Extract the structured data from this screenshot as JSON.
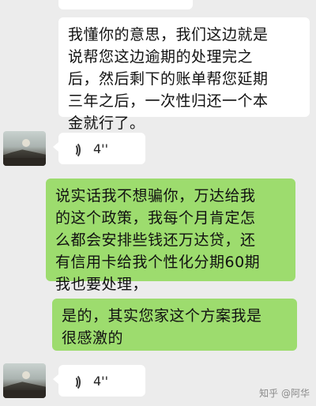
{
  "messages": [
    {
      "lines": [
        "我懂你的意思，我们这边就是",
        "说帮您这边逾期的处理完之",
        "后，然后剩下的账单帮您延期",
        "三年之后，一次性归还一个本",
        "金就行了。"
      ]
    },
    {
      "voice_duration": "4''"
    },
    {
      "lines": [
        "说实话我不想骗你，万达给我",
        "的这个政策，我每个月肯定怎",
        "么都会安排些钱还万达贷，还",
        "有信用卡给我个性化分期60期",
        "我也要处理，"
      ]
    },
    {
      "lines": [
        "是的，其实您家这个方案我是",
        "很感激的"
      ]
    },
    {
      "voice_duration": "4''"
    }
  ],
  "watermark": "知乎 @阿华"
}
